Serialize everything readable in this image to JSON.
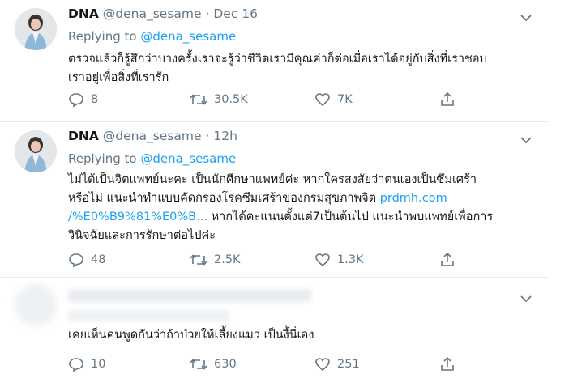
{
  "tweets": [
    {
      "name": "DNA",
      "handle": "@dena_sesame",
      "separator": "·",
      "time": "Dec 16",
      "replying_prefix": "Replying to",
      "replying_to": "@dena_sesame",
      "lines": [
        "ตรวจแล้วก็รู้สึกว่าบางครั้งเราจะรู้ว่าชีวิตเรามีคุณค่าก็ต่อเมื่อเราได้อยู่กับสิ่งที่เราชอบ",
        "เราอยู่เพื่อสิ่งที่เรารัก"
      ],
      "replies": "8",
      "retweets": "30.5K",
      "likes": "7K"
    },
    {
      "name": "DNA",
      "handle": "@dena_sesame",
      "separator": "·",
      "time": "12h",
      "replying_prefix": "Replying to",
      "replying_to": "@dena_sesame",
      "line1": "ไม่ได้เป็นจิตแพทย์นะคะ เป็นนักศึกษาแพทย์ค่ะ หากใครสงสัยว่าตนเองเป็นซึมเศร้า",
      "line2_text": "หรือไม่ แนะนำทำแบบคัดกรองโรคซึมเศร้าของกรมสุขภาพจิต",
      "line2_link": "prdmh.com",
      "line3_link": "/%E0%B9%81%E0%B...",
      "line3_text": "หากได้คะแนนตั้งแต่7เป็นต้นไป แนะนำพบแพทย์เพื่อการ",
      "line4": "วินิจฉัยและการรักษาต่อไปค่ะ",
      "replies": "48",
      "retweets": "2.5K",
      "likes": "1.3K"
    },
    {
      "body": "เคยเห็นคนพูดกันว่าถ้าป่วยให้เลี้ยงแมว เป็นงี้นี่เอง",
      "replies": "10",
      "retweets": "630",
      "likes": "251"
    }
  ],
  "icons": {
    "chevron": "chevron-down-icon",
    "reply": "reply-icon",
    "retweet": "retweet-icon",
    "like": "heart-icon",
    "share": "share-icon"
  },
  "colors": {
    "link": "#1da1f2",
    "muted": "#657786",
    "text": "#14171a",
    "divider": "#e6ecf0"
  }
}
